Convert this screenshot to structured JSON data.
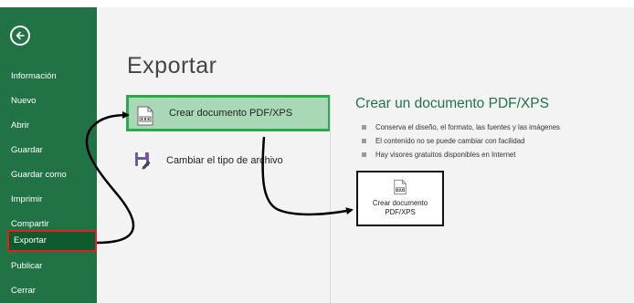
{
  "sidebar": {
    "back_label": "←",
    "items": [
      {
        "label": "Información"
      },
      {
        "label": "Nuevo"
      },
      {
        "label": "Abrir"
      },
      {
        "label": "Guardar"
      },
      {
        "label": "Guardar como"
      },
      {
        "label": "Imprimir"
      },
      {
        "label": "Compartir"
      },
      {
        "label": "Exportar",
        "active": true
      },
      {
        "label": "Publicar"
      },
      {
        "label": "Cerrar"
      }
    ],
    "background_color": "#217346",
    "highlight_color": "#e02020"
  },
  "main": {
    "title": "Exportar",
    "options": [
      {
        "label": "Crear documento PDF/XPS",
        "icon": "pdf-document-icon",
        "selected": true
      },
      {
        "label": "Cambiar el tipo de archivo",
        "icon": "save-as-file-icon",
        "selected": false
      }
    ]
  },
  "detail": {
    "title": "Crear un documento PDF/XPS",
    "bullets": [
      "Conserva el diseño, el formato, las fuentes y las imágenes",
      "El contenido no se puede cambiar con facilidad",
      "Hay visores gratuitos disponibles en Internet"
    ],
    "button_label": "Crear documento PDF/XPS",
    "button_icon": "pdf-document-icon",
    "accent_color": "#217346"
  },
  "annotations": {
    "arrow_color": "#000000",
    "selection_color": "#2ea84a"
  }
}
